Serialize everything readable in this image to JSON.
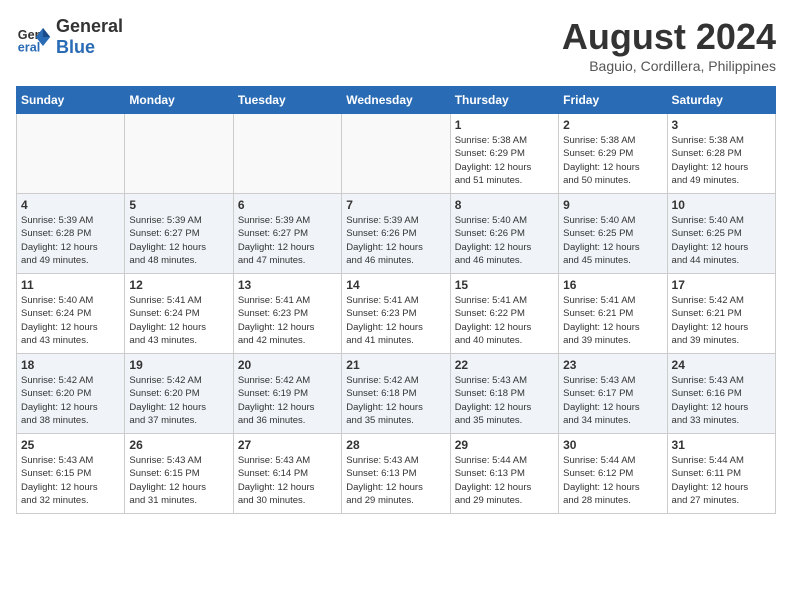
{
  "header": {
    "logo_general": "General",
    "logo_blue": "Blue",
    "title": "August 2024",
    "subtitle": "Baguio, Cordillera, Philippines"
  },
  "days_of_week": [
    "Sunday",
    "Monday",
    "Tuesday",
    "Wednesday",
    "Thursday",
    "Friday",
    "Saturday"
  ],
  "weeks": [
    [
      {
        "day": "",
        "info": "",
        "empty": true
      },
      {
        "day": "",
        "info": "",
        "empty": true
      },
      {
        "day": "",
        "info": "",
        "empty": true
      },
      {
        "day": "",
        "info": "",
        "empty": true
      },
      {
        "day": "1",
        "info": "Sunrise: 5:38 AM\nSunset: 6:29 PM\nDaylight: 12 hours\nand 51 minutes.",
        "empty": false
      },
      {
        "day": "2",
        "info": "Sunrise: 5:38 AM\nSunset: 6:29 PM\nDaylight: 12 hours\nand 50 minutes.",
        "empty": false
      },
      {
        "day": "3",
        "info": "Sunrise: 5:38 AM\nSunset: 6:28 PM\nDaylight: 12 hours\nand 49 minutes.",
        "empty": false
      }
    ],
    [
      {
        "day": "4",
        "info": "Sunrise: 5:39 AM\nSunset: 6:28 PM\nDaylight: 12 hours\nand 49 minutes.",
        "empty": false
      },
      {
        "day": "5",
        "info": "Sunrise: 5:39 AM\nSunset: 6:27 PM\nDaylight: 12 hours\nand 48 minutes.",
        "empty": false
      },
      {
        "day": "6",
        "info": "Sunrise: 5:39 AM\nSunset: 6:27 PM\nDaylight: 12 hours\nand 47 minutes.",
        "empty": false
      },
      {
        "day": "7",
        "info": "Sunrise: 5:39 AM\nSunset: 6:26 PM\nDaylight: 12 hours\nand 46 minutes.",
        "empty": false
      },
      {
        "day": "8",
        "info": "Sunrise: 5:40 AM\nSunset: 6:26 PM\nDaylight: 12 hours\nand 46 minutes.",
        "empty": false
      },
      {
        "day": "9",
        "info": "Sunrise: 5:40 AM\nSunset: 6:25 PM\nDaylight: 12 hours\nand 45 minutes.",
        "empty": false
      },
      {
        "day": "10",
        "info": "Sunrise: 5:40 AM\nSunset: 6:25 PM\nDaylight: 12 hours\nand 44 minutes.",
        "empty": false
      }
    ],
    [
      {
        "day": "11",
        "info": "Sunrise: 5:40 AM\nSunset: 6:24 PM\nDaylight: 12 hours\nand 43 minutes.",
        "empty": false
      },
      {
        "day": "12",
        "info": "Sunrise: 5:41 AM\nSunset: 6:24 PM\nDaylight: 12 hours\nand 43 minutes.",
        "empty": false
      },
      {
        "day": "13",
        "info": "Sunrise: 5:41 AM\nSunset: 6:23 PM\nDaylight: 12 hours\nand 42 minutes.",
        "empty": false
      },
      {
        "day": "14",
        "info": "Sunrise: 5:41 AM\nSunset: 6:23 PM\nDaylight: 12 hours\nand 41 minutes.",
        "empty": false
      },
      {
        "day": "15",
        "info": "Sunrise: 5:41 AM\nSunset: 6:22 PM\nDaylight: 12 hours\nand 40 minutes.",
        "empty": false
      },
      {
        "day": "16",
        "info": "Sunrise: 5:41 AM\nSunset: 6:21 PM\nDaylight: 12 hours\nand 39 minutes.",
        "empty": false
      },
      {
        "day": "17",
        "info": "Sunrise: 5:42 AM\nSunset: 6:21 PM\nDaylight: 12 hours\nand 39 minutes.",
        "empty": false
      }
    ],
    [
      {
        "day": "18",
        "info": "Sunrise: 5:42 AM\nSunset: 6:20 PM\nDaylight: 12 hours\nand 38 minutes.",
        "empty": false
      },
      {
        "day": "19",
        "info": "Sunrise: 5:42 AM\nSunset: 6:20 PM\nDaylight: 12 hours\nand 37 minutes.",
        "empty": false
      },
      {
        "day": "20",
        "info": "Sunrise: 5:42 AM\nSunset: 6:19 PM\nDaylight: 12 hours\nand 36 minutes.",
        "empty": false
      },
      {
        "day": "21",
        "info": "Sunrise: 5:42 AM\nSunset: 6:18 PM\nDaylight: 12 hours\nand 35 minutes.",
        "empty": false
      },
      {
        "day": "22",
        "info": "Sunrise: 5:43 AM\nSunset: 6:18 PM\nDaylight: 12 hours\nand 35 minutes.",
        "empty": false
      },
      {
        "day": "23",
        "info": "Sunrise: 5:43 AM\nSunset: 6:17 PM\nDaylight: 12 hours\nand 34 minutes.",
        "empty": false
      },
      {
        "day": "24",
        "info": "Sunrise: 5:43 AM\nSunset: 6:16 PM\nDaylight: 12 hours\nand 33 minutes.",
        "empty": false
      }
    ],
    [
      {
        "day": "25",
        "info": "Sunrise: 5:43 AM\nSunset: 6:15 PM\nDaylight: 12 hours\nand 32 minutes.",
        "empty": false
      },
      {
        "day": "26",
        "info": "Sunrise: 5:43 AM\nSunset: 6:15 PM\nDaylight: 12 hours\nand 31 minutes.",
        "empty": false
      },
      {
        "day": "27",
        "info": "Sunrise: 5:43 AM\nSunset: 6:14 PM\nDaylight: 12 hours\nand 30 minutes.",
        "empty": false
      },
      {
        "day": "28",
        "info": "Sunrise: 5:43 AM\nSunset: 6:13 PM\nDaylight: 12 hours\nand 29 minutes.",
        "empty": false
      },
      {
        "day": "29",
        "info": "Sunrise: 5:44 AM\nSunset: 6:13 PM\nDaylight: 12 hours\nand 29 minutes.",
        "empty": false
      },
      {
        "day": "30",
        "info": "Sunrise: 5:44 AM\nSunset: 6:12 PM\nDaylight: 12 hours\nand 28 minutes.",
        "empty": false
      },
      {
        "day": "31",
        "info": "Sunrise: 5:44 AM\nSunset: 6:11 PM\nDaylight: 12 hours\nand 27 minutes.",
        "empty": false
      }
    ]
  ]
}
